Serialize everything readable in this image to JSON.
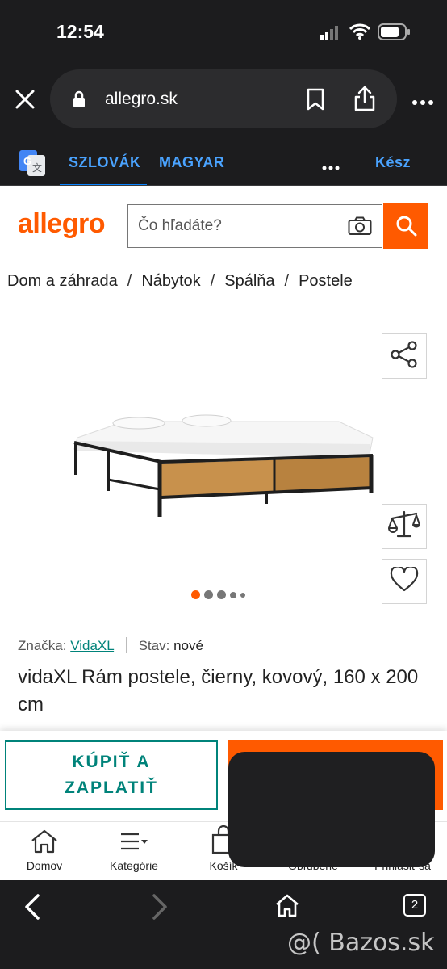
{
  "status_bar": {
    "time": "12:54"
  },
  "browser": {
    "url": "allegro.sk",
    "translate_tabs": [
      "SZLOVÁK",
      "MAGYAR"
    ],
    "done_label": "Kész",
    "tab_count": "2"
  },
  "header": {
    "logo": "allegro",
    "search_placeholder": "Čo hľadáte?"
  },
  "breadcrumbs": [
    "Dom a záhrada",
    "Nábytok",
    "Spálňa",
    "Postele"
  ],
  "product": {
    "brand_label": "Značka:",
    "brand": "VidaXL",
    "condition_label": "Stav:",
    "condition": "nové",
    "title": "vidaXL Rám postele, čierny, kovový, 160 x 200 cm",
    "gallery": {
      "image_count": 5,
      "active_index": 0
    }
  },
  "actions": {
    "buy_now": "KÚPIŤ A ZAPLATIŤ"
  },
  "bottom_nav": [
    "Domov",
    "Kategórie",
    "Košík",
    "Obľúbené",
    "Prihlásiť sa"
  ],
  "watermark": "@( Bazos.sk",
  "colors": {
    "brand": "#ff5a00",
    "accent": "#00837a",
    "chrome": "#1c1c1e",
    "translate_blue": "#0a84ff"
  }
}
